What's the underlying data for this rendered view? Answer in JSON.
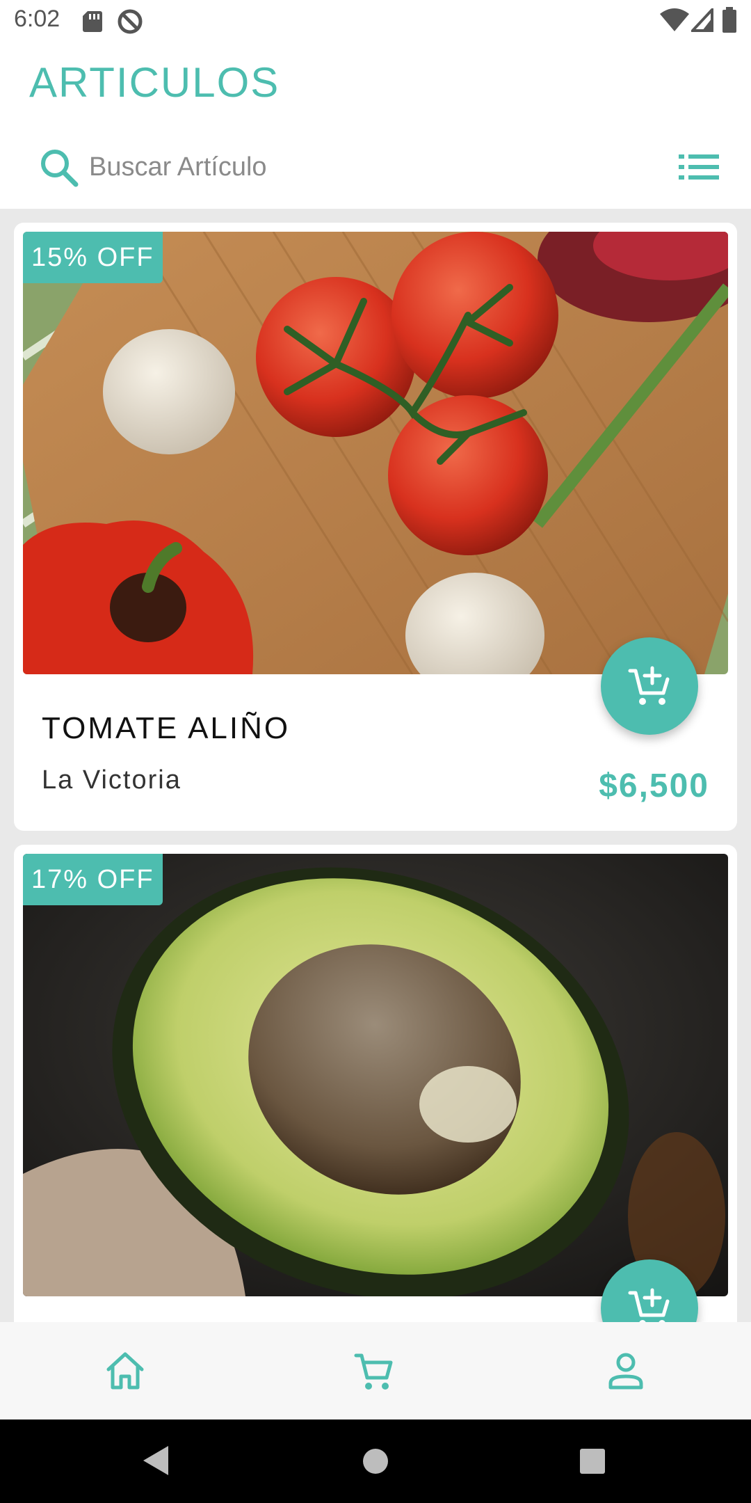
{
  "status_bar": {
    "time": "6:02"
  },
  "header": {
    "title": "ARTICULOS"
  },
  "search": {
    "placeholder": "Buscar Artículo"
  },
  "products": [
    {
      "discount": "15% OFF",
      "name": "TOMATE ALIÑO",
      "store": "La Victoria",
      "price": "$6,500"
    },
    {
      "discount": "17% OFF",
      "name": "",
      "store": "",
      "price": ""
    }
  ],
  "colors": {
    "accent": "#4dbdaf",
    "text": "#111111",
    "nav_background": "#f7f7f7"
  },
  "icons": {
    "status": [
      "sd-card-icon",
      "do-not-disturb-icon",
      "wifi-icon",
      "signal-icon",
      "battery-icon"
    ],
    "search": "search-icon",
    "list_view": "list-view-icon",
    "add_to_cart": "add-shopping-cart-icon",
    "nav": [
      "home-icon",
      "cart-icon",
      "person-icon"
    ],
    "system": [
      "back-icon",
      "home-circle-icon",
      "recents-icon"
    ]
  }
}
